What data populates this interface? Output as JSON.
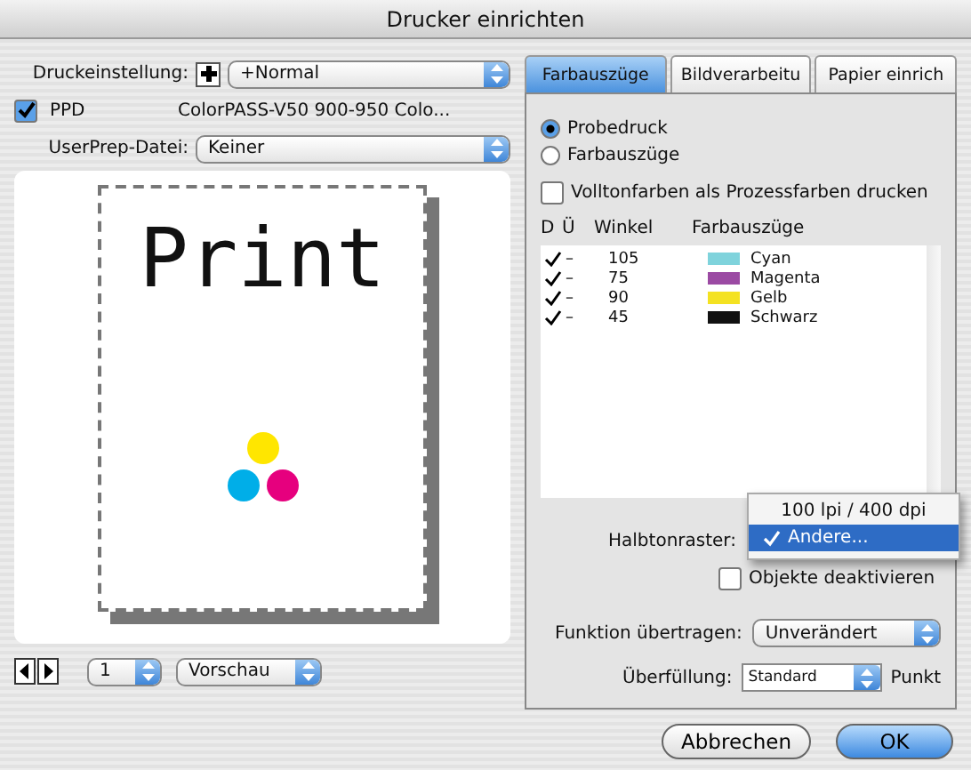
{
  "window": {
    "title": "Drucker einrichten"
  },
  "print_setting": {
    "label": "Druckeinstellung:",
    "value": "+Normal"
  },
  "ppd": {
    "label": "PPD",
    "checked": true,
    "value": "ColorPASS-V50 900-950 Colo..."
  },
  "userprep": {
    "label": "UserPrep-Datei:",
    "value": "Keiner"
  },
  "preview": {
    "text": "Print"
  },
  "page_select": {
    "value": "1"
  },
  "view_select": {
    "value": "Vorschau"
  },
  "tabs": [
    {
      "label": "Farbauszüge",
      "selected": true
    },
    {
      "label": "Bildverarbeitu",
      "selected": false
    },
    {
      "label": "Papier einrich",
      "selected": false
    }
  ],
  "output_mode": [
    {
      "label": "Probedruck",
      "selected": true
    },
    {
      "label": "Farbauszüge",
      "selected": false
    }
  ],
  "spot_to_process": {
    "label": "Volltonfarben als Prozessfarben drucken",
    "checked": false
  },
  "plates": {
    "columns": [
      "D",
      "Ü",
      "Winkel",
      "Farbauszüge"
    ],
    "rows": [
      {
        "checked": true,
        "overprint": "–",
        "angle": "105",
        "color": "#7fd3dc",
        "name": "Cyan"
      },
      {
        "checked": true,
        "overprint": "–",
        "angle": "75",
        "color": "#9b4aa3",
        "name": "Magenta"
      },
      {
        "checked": true,
        "overprint": "–",
        "angle": "90",
        "color": "#f4e222",
        "name": "Gelb"
      },
      {
        "checked": true,
        "overprint": "–",
        "angle": "45",
        "color": "#111111",
        "name": "Schwarz"
      }
    ]
  },
  "halftone": {
    "label": "Halbtonraster:",
    "options": [
      {
        "label": "100 lpi / 400 dpi",
        "selected": false
      },
      {
        "label": "Andere...",
        "selected": true
      }
    ]
  },
  "disable_objects": {
    "label": "Objekte deaktivieren",
    "checked": false
  },
  "transfer": {
    "label": "Funktion übertragen:",
    "value": "Unverändert"
  },
  "trapping": {
    "label": "Überfüllung:",
    "value": "Standard",
    "unit": "Punkt"
  },
  "buttons": [
    {
      "label": "Abbrechen",
      "default": false
    },
    {
      "label": "OK",
      "default": true
    }
  ]
}
